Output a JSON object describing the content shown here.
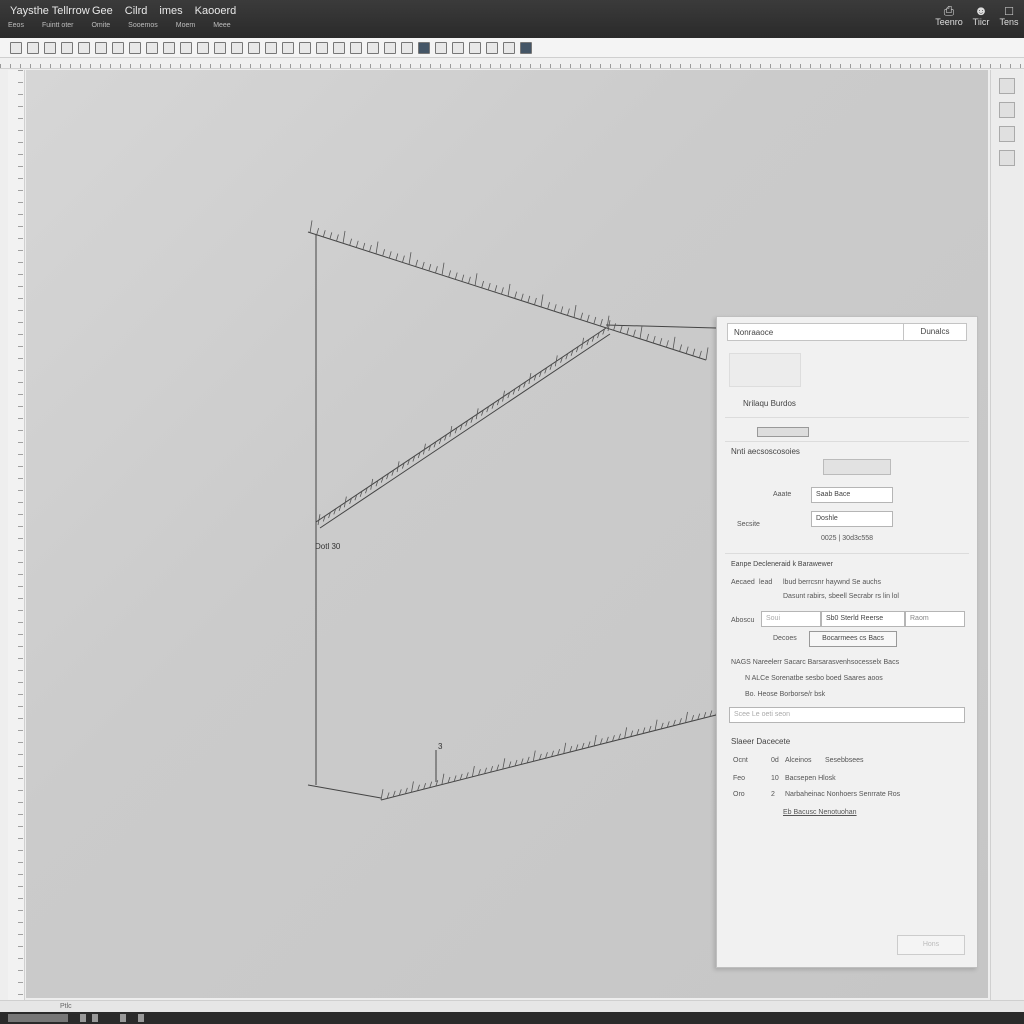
{
  "titlebar": {
    "app_title": "Yaysthe Tellrrow",
    "menus": [
      "Gee",
      "Cilrd",
      "imes",
      "Kaooerd"
    ],
    "submenus": [
      "Eeos",
      "Fuintt oter",
      "Omite",
      "Sooemos",
      "Moem",
      "Meee"
    ],
    "right_items": [
      {
        "label": "Teenro",
        "icon": "printer-icon"
      },
      {
        "label": "Tiicr",
        "icon": "user-icon"
      },
      {
        "label": "Tens",
        "icon": "window-icon"
      }
    ]
  },
  "canvas": {
    "label_left": "Dotl 30",
    "label_small": "3"
  },
  "panel": {
    "header_title": "Nonraaoce",
    "header_tab": "Dunalcs",
    "section_title": "Nrilaqu Burdos",
    "subheading": "Nnti aecsoscosoies",
    "field_value": "Saab Bace",
    "field_small": "Doshle",
    "field_label": "Secsite",
    "field_side_label": "Aaate",
    "coord_text": "0025 | 30d3c558",
    "group_title": "Eanpe Decleneraid k Barawewer",
    "row1_label": "Aecaed",
    "row1_value": "lead",
    "row1_text": "lbud berrcsnr haywnd Se auchs",
    "row1_subtext": "Dasunt rabirs, sbeell Secrabr rs lin lol",
    "search_label": "Aboscu",
    "search_placeholder": "Soui",
    "search_value": "Sb0 Sterld Reerse",
    "search_right": "Raom",
    "sub_label": "Decoes",
    "action_button": "Bocarmees cs Bacs",
    "desc_text": "NAGS Nareelerr Sacarc Barsarasvenhsocesselx Bacs",
    "bullet1": "N ALCe Sorenatbe sesbo boed Saares aoos",
    "bullet2": "Bo. Heose Borborse/r bsk",
    "input_placeholder": "Scee Le oeti seon",
    "list_title": "Slaeer Dacecete",
    "list": [
      {
        "num": "Ocnt",
        "icon": "0d",
        "name": "Alceinos",
        "value": "Sesebbsees"
      },
      {
        "num": "Feo",
        "icon": "10",
        "name": "Bacsepen Hlosk",
        "value": ""
      },
      {
        "num": "Oro",
        "icon": "2",
        "name": "Narbaheinac Nonhoers Senrrate Ros",
        "value": ""
      }
    ],
    "footer_link": "Eb Bacusc Nenotuohan",
    "ok_button": "Hons"
  },
  "statusbar": {
    "text": "Ptlc"
  }
}
